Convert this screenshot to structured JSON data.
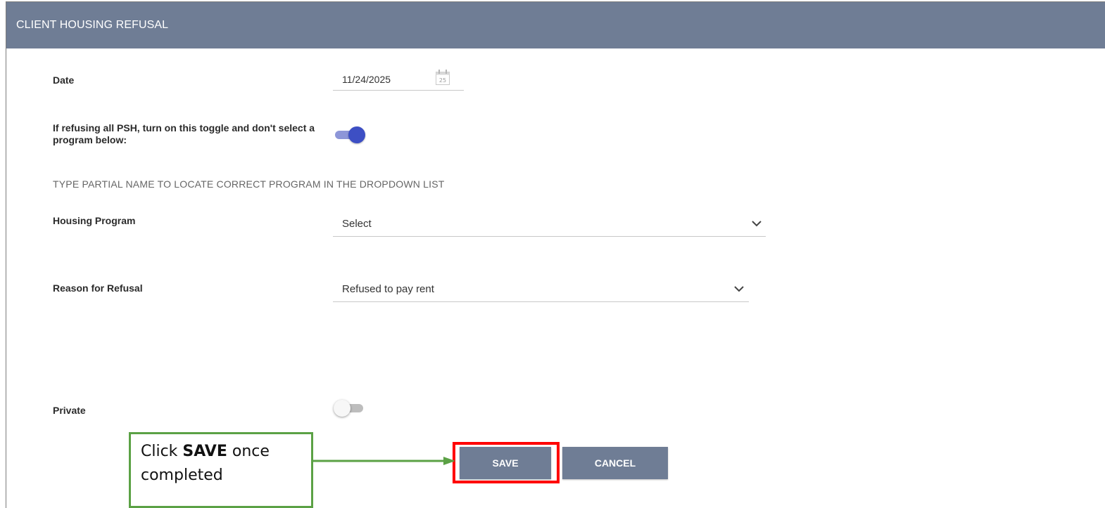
{
  "header": {
    "title": "CLIENT HOUSING REFUSAL"
  },
  "form": {
    "date_label": "Date",
    "date_value": "11/24/2025",
    "calendar_day": "25",
    "psh_toggle_label": "If refusing all PSH, turn on this toggle and don't select a program below:",
    "psh_toggle_on": true,
    "hint": "TYPE PARTIAL NAME TO LOCATE CORRECT PROGRAM IN THE DROPDOWN LIST",
    "housing_program_label": "Housing Program",
    "housing_program_value": "Select",
    "reason_label": "Reason for Refusal",
    "reason_value": "Refused to pay rent",
    "private_label": "Private",
    "private_on": false
  },
  "actions": {
    "save_label": "SAVE",
    "cancel_label": "CANCEL"
  },
  "annotation": {
    "text_pre": "Click ",
    "text_bold": "SAVE",
    "text_post": " once completed",
    "box_color": "#5ba145",
    "highlight_color": "#ff0000"
  },
  "colors": {
    "header_bg": "#6f7d95",
    "toggle_on": "#3d4fc4",
    "button_bg": "#6f7d95"
  }
}
